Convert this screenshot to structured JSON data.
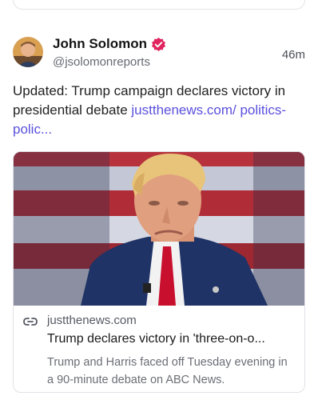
{
  "post": {
    "author": {
      "display_name": "John Solomon",
      "handle": "@jsolomonreports",
      "verified_icon": "verified-badge-icon",
      "avatar_icon": "avatar"
    },
    "timestamp": "46m",
    "text": "Updated: Trump campaign declares victory in presidential debate ",
    "link_text": "justthenews.com/ politics-polic...",
    "link_card": {
      "domain": "justthenews.com",
      "title": "Trump declares victory in 'three-on-o...",
      "description": "Trump and Harris faced off Tuesday evening in a 90-minute debate on ABC News.",
      "link_icon": "link-icon"
    }
  },
  "colors": {
    "link": "#5a50dc",
    "verified": "#e0245e",
    "accent": "#9a8ef0"
  }
}
